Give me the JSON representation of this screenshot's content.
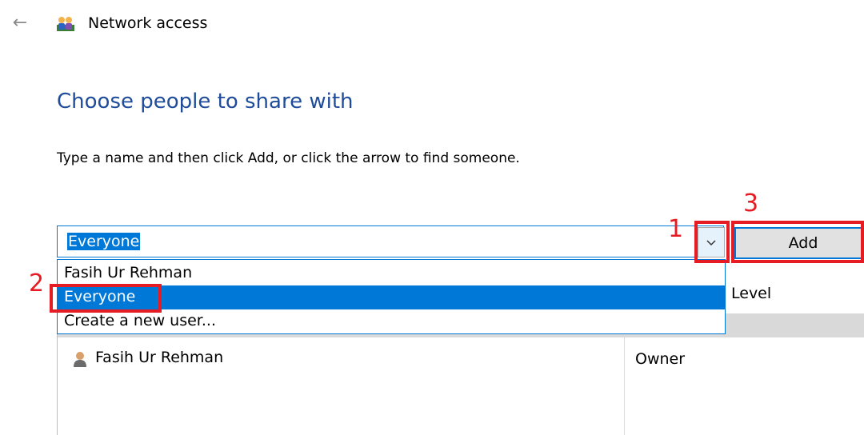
{
  "header": {
    "window_title": "Network access",
    "back_icon": "back-arrow-icon",
    "title_icon": "network-users-icon"
  },
  "main": {
    "heading": "Choose people to share with",
    "instruction": "Type a name and then click Add, or click the arrow to find someone."
  },
  "combo": {
    "value": "Everyone",
    "dropdown_icon": "chevron-down-icon",
    "options": [
      "Fasih Ur Rehman",
      "Everyone",
      "Create a new user..."
    ],
    "selected_index": 1
  },
  "add_button": {
    "label": "Add"
  },
  "table": {
    "column_level": "Level",
    "rows": [
      {
        "name": "Fasih Ur Rehman",
        "level": "Owner",
        "icon": "user-icon"
      }
    ]
  },
  "annotations": {
    "step1": "1",
    "step2": "2",
    "step3": "3"
  },
  "colors": {
    "heading": "#1e4c9a",
    "accent": "#0078d7",
    "annotation": "#e51c23"
  }
}
